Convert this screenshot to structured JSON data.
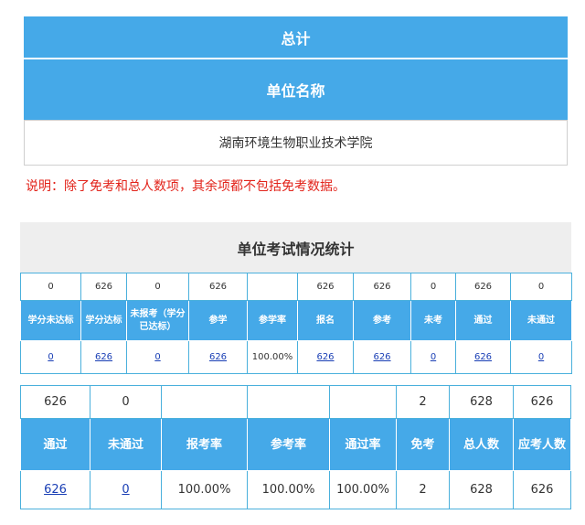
{
  "summary": {
    "total_header": "总计",
    "unit_header": "单位名称",
    "unit_name": "湖南环境生物职业技术学院",
    "note": "说明：除了免考和总人数项，其余项都不包括免考数据。"
  },
  "stats": {
    "title": "单位考试情况统计",
    "table1": {
      "top_values": [
        "0",
        "626",
        "0",
        "626",
        "",
        "626",
        "626",
        "0",
        "626",
        "0"
      ],
      "headers": [
        "学分未达标",
        "学分达标",
        "未报考（学分已达标）",
        "参学",
        "参学率",
        "报名",
        "参考",
        "未考",
        "通过",
        "未通过"
      ],
      "values": [
        "0",
        "626",
        "0",
        "626",
        "100.00%",
        "626",
        "626",
        "0",
        "626",
        "0"
      ]
    },
    "table2": {
      "top_values": [
        "626",
        "0",
        "",
        "",
        "",
        "2",
        "628",
        "626"
      ],
      "headers": [
        "通过",
        "未通过",
        "报考率",
        "参考率",
        "通过率",
        "免考",
        "总人数",
        "应考人数"
      ],
      "values": [
        "626",
        "0",
        "100.00%",
        "100.00%",
        "100.00%",
        "2",
        "628",
        "626"
      ]
    }
  },
  "colors": {
    "header_blue": "#45a9e8",
    "note_red": "#e2231a",
    "link_blue": "#1a3fb5"
  }
}
